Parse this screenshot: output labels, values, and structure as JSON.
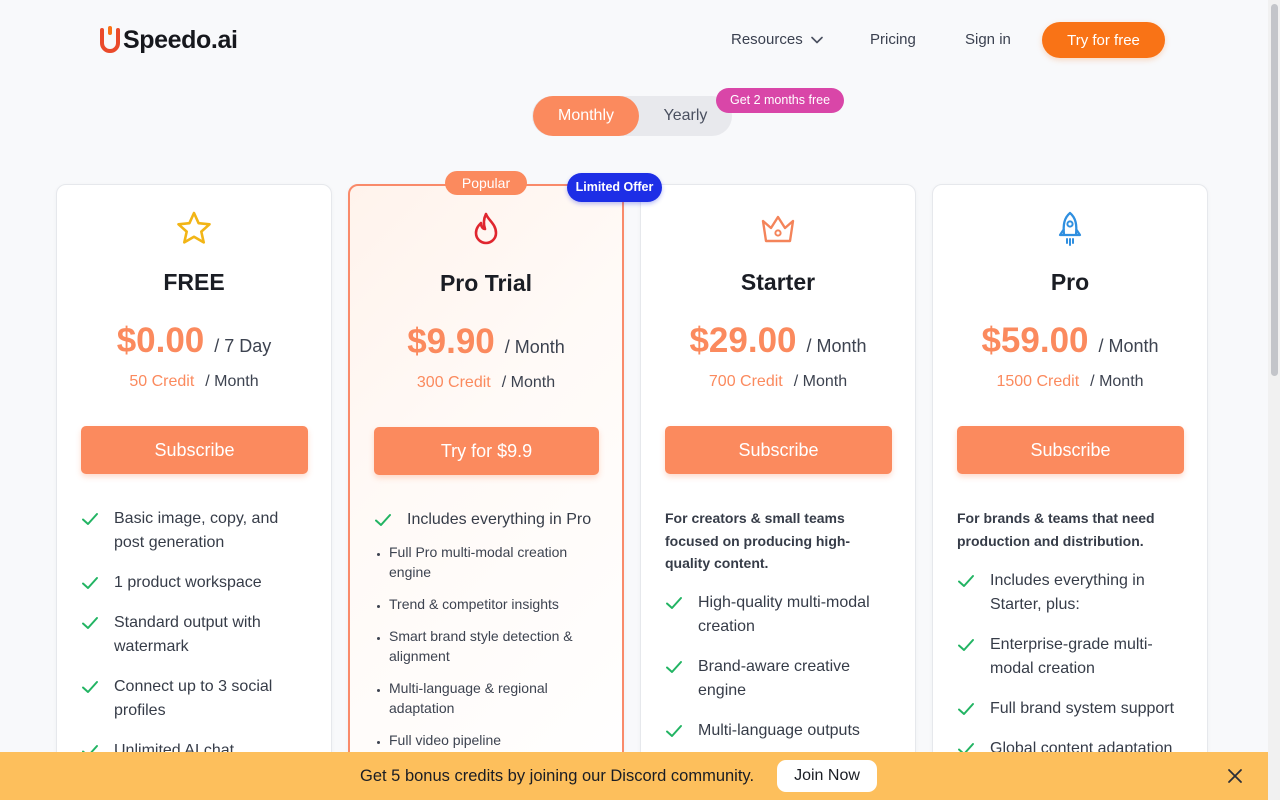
{
  "brand": {
    "name": "Speedo.ai",
    "accent": "#f97316"
  },
  "nav": {
    "resources": "Resources",
    "pricing": "Pricing",
    "sign_in": "Sign in",
    "try_free": "Try for free"
  },
  "billing": {
    "monthly": "Monthly",
    "yearly": "Yearly",
    "selected": "Monthly",
    "yearly_badge": "Get 2 months free"
  },
  "plans": [
    {
      "name": "FREE",
      "icon": "star-icon",
      "price": "$0.00",
      "period": "/ 7 Day",
      "credit": "50 Credit",
      "credit_unit": "/ Month",
      "cta": "Subscribe",
      "features": [
        "Basic image, copy, and post generation",
        "1 product workspace",
        "Standard output with watermark",
        "Connect up to 3 social profiles",
        "Unlimited AI chat"
      ]
    },
    {
      "name": "Pro Trial",
      "icon": "flame-icon",
      "badge": "Popular",
      "badge_secondary": "Limited Offer",
      "price": "$9.90",
      "period": "/ Month",
      "credit": "300 Credit",
      "credit_unit": "/ Month",
      "cta": "Try for $9.9",
      "features": [
        "Includes everything in Pro"
      ],
      "sub_features": [
        "Full Pro multi-modal creation engine",
        "Trend & competitor insights",
        "Smart brand style detection & alignment",
        "Multi-language & regional adaptation",
        "Full video pipeline"
      ]
    },
    {
      "name": "Starter",
      "icon": "crown-icon",
      "price": "$29.00",
      "period": "/ Month",
      "credit": "700 Credit",
      "credit_unit": "/ Month",
      "cta": "Subscribe",
      "tagline": "For creators & small teams focused on producing high-quality content.",
      "features": [
        "High-quality multi-modal creation",
        "Brand-aware creative engine",
        "Multi-language outputs"
      ]
    },
    {
      "name": "Pro",
      "icon": "rocket-icon",
      "price": "$59.00",
      "period": "/ Month",
      "credit": "1500 Credit",
      "credit_unit": "/ Month",
      "cta": "Subscribe",
      "tagline": "For brands & teams that need production and distribution.",
      "features": [
        "Includes everything in Starter, plus:",
        "Enterprise-grade multi-modal creation",
        "Full brand system support",
        "Global content adaptation"
      ]
    }
  ],
  "banner": {
    "text": "Get 5 bonus credits by joining our Discord community.",
    "join": "Join Now"
  },
  "colors": {
    "plan_orange": "#fb8a5e",
    "check_green": "#22b463",
    "popular_border": "#f98a6a",
    "limited_badge": "#1d2ee6",
    "yearly_badge": "#d946a8",
    "banner_bg": "#fdbf5c"
  }
}
